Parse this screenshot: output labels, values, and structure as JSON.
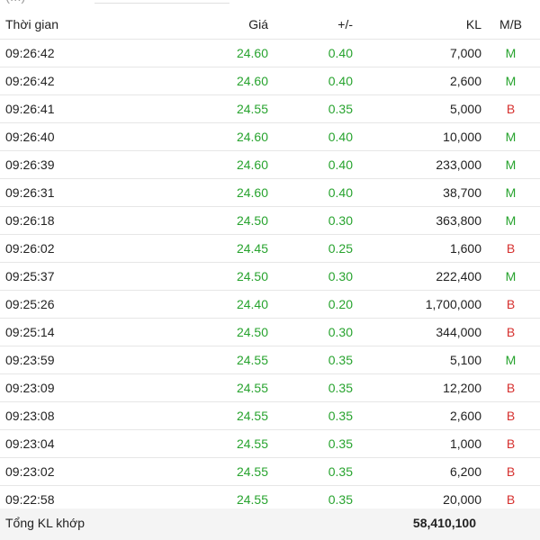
{
  "top_cut": {
    "text": "(...)"
  },
  "headers": {
    "time": "Thời gian",
    "price": "Giá",
    "change": "+/-",
    "volume": "KL",
    "side": "M/B"
  },
  "colors": {
    "up": "#27a32e",
    "buy": "#27a32e",
    "sell": "#d6312f"
  },
  "rows": [
    {
      "time": "09:26:42",
      "price": "24.60",
      "change": "0.40",
      "volume": "7,000",
      "side": "M"
    },
    {
      "time": "09:26:42",
      "price": "24.60",
      "change": "0.40",
      "volume": "2,600",
      "side": "M"
    },
    {
      "time": "09:26:41",
      "price": "24.55",
      "change": "0.35",
      "volume": "5,000",
      "side": "B"
    },
    {
      "time": "09:26:40",
      "price": "24.60",
      "change": "0.40",
      "volume": "10,000",
      "side": "M"
    },
    {
      "time": "09:26:39",
      "price": "24.60",
      "change": "0.40",
      "volume": "233,000",
      "side": "M"
    },
    {
      "time": "09:26:31",
      "price": "24.60",
      "change": "0.40",
      "volume": "38,700",
      "side": "M"
    },
    {
      "time": "09:26:18",
      "price": "24.50",
      "change": "0.30",
      "volume": "363,800",
      "side": "M"
    },
    {
      "time": "09:26:02",
      "price": "24.45",
      "change": "0.25",
      "volume": "1,600",
      "side": "B"
    },
    {
      "time": "09:25:37",
      "price": "24.50",
      "change": "0.30",
      "volume": "222,400",
      "side": "M"
    },
    {
      "time": "09:25:26",
      "price": "24.40",
      "change": "0.20",
      "volume": "1,700,000",
      "side": "B"
    },
    {
      "time": "09:25:14",
      "price": "24.50",
      "change": "0.30",
      "volume": "344,000",
      "side": "B"
    },
    {
      "time": "09:23:59",
      "price": "24.55",
      "change": "0.35",
      "volume": "5,100",
      "side": "M"
    },
    {
      "time": "09:23:09",
      "price": "24.55",
      "change": "0.35",
      "volume": "12,200",
      "side": "B"
    },
    {
      "time": "09:23:08",
      "price": "24.55",
      "change": "0.35",
      "volume": "2,600",
      "side": "B"
    },
    {
      "time": "09:23:04",
      "price": "24.55",
      "change": "0.35",
      "volume": "1,000",
      "side": "B"
    },
    {
      "time": "09:23:02",
      "price": "24.55",
      "change": "0.35",
      "volume": "6,200",
      "side": "B"
    },
    {
      "time": "09:22:58",
      "price": "24.55",
      "change": "0.35",
      "volume": "20,000",
      "side": "B"
    }
  ],
  "footer": {
    "label": "Tổng KL khớp",
    "total": "58,410,100"
  }
}
